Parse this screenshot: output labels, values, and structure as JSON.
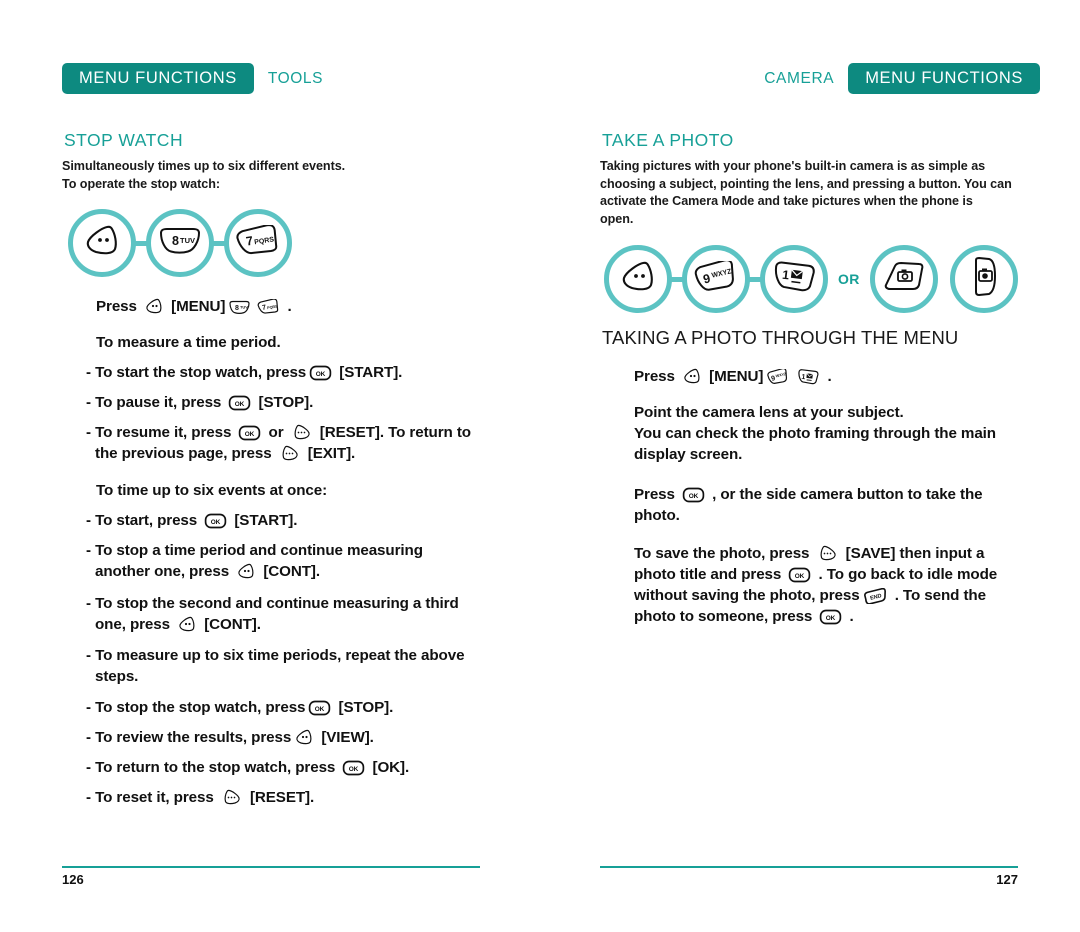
{
  "document": {
    "type": "mobile-phone-user-manual-spread",
    "accent_dark": "#0d8a80",
    "accent_mid": "#17a097",
    "accent_light": "#5cc3c3"
  },
  "left_page": {
    "running_head": {
      "badge_label": "MENU FUNCTIONS",
      "section_label": "TOOLS"
    },
    "topic_heading": "STOP WATCH",
    "intro_lines": [
      "Simultaneously times up to six different events.",
      "To operate the stop watch:"
    ],
    "key_sequence": [
      {
        "icon": "softkey-left-menu",
        "label": ""
      },
      {
        "icon": "numkey",
        "label": "8",
        "letters": "TUV"
      },
      {
        "icon": "numkey",
        "label": "7",
        "letters": "PQRS"
      }
    ],
    "steps": [
      {
        "name": "press-menu-8-7",
        "parts": [
          {
            "t": "text",
            "v": "Press "
          },
          {
            "t": "key",
            "v": "softkey-left"
          },
          {
            "t": "text",
            "v": " [MENU]"
          },
          {
            "t": "key",
            "v": "num8"
          },
          {
            "t": "key",
            "v": "num7"
          },
          {
            "t": "text",
            "v": " ."
          }
        ]
      },
      {
        "name": "measure-time-period-heading",
        "parts": [
          {
            "t": "text",
            "v": "To measure a time period."
          }
        ]
      },
      {
        "name": "start-stop-watch",
        "parts": [
          {
            "t": "text",
            "v": "- To start the stop watch, press"
          },
          {
            "t": "key",
            "v": "ok"
          },
          {
            "t": "text",
            "v": " [START]."
          }
        ]
      },
      {
        "name": "pause-it",
        "parts": [
          {
            "t": "text",
            "v": "- To pause it, press "
          },
          {
            "t": "key",
            "v": "ok"
          },
          {
            "t": "text",
            "v": " [STOP]."
          }
        ]
      },
      {
        "name": "resume-it",
        "parts": [
          {
            "t": "text",
            "v": "- To resume it, press "
          },
          {
            "t": "key",
            "v": "ok"
          },
          {
            "t": "text",
            "v": " or "
          },
          {
            "t": "key",
            "v": "softkey-right"
          },
          {
            "t": "text",
            "v": " [RESET]. To return to"
          },
          {
            "t": "br"
          },
          {
            "t": "text",
            "v": "the previous page, press "
          },
          {
            "t": "key",
            "v": "softkey-right"
          },
          {
            "t": "text",
            "v": " [EXIT]."
          }
        ]
      },
      {
        "name": "six-events-heading",
        "parts": [
          {
            "t": "text",
            "v": "To time up to six events at once:"
          }
        ]
      },
      {
        "name": "start-press",
        "parts": [
          {
            "t": "text",
            "v": "- To start, press "
          },
          {
            "t": "key",
            "v": "ok"
          },
          {
            "t": "text",
            "v": " [START]."
          }
        ]
      },
      {
        "name": "stop-and-continue",
        "parts": [
          {
            "t": "text",
            "v": "- To stop a time period and continue measuring"
          },
          {
            "t": "br"
          },
          {
            "t": "text",
            "v": "another one, press "
          },
          {
            "t": "key",
            "v": "softkey-left"
          },
          {
            "t": "text",
            "v": " [CONT]."
          }
        ]
      },
      {
        "name": "stop-second-continue-third",
        "parts": [
          {
            "t": "text",
            "v": "- To stop the second and continue measuring a third"
          },
          {
            "t": "br"
          },
          {
            "t": "text",
            "v": "one, press "
          },
          {
            "t": "key",
            "v": "softkey-left"
          },
          {
            "t": "text",
            "v": " [CONT]."
          }
        ]
      },
      {
        "name": "measure-six-periods",
        "parts": [
          {
            "t": "text",
            "v": "- To measure up to six time periods, repeat the above"
          },
          {
            "t": "br"
          },
          {
            "t": "text",
            "v": "steps."
          }
        ]
      },
      {
        "name": "stop-the-stop-watch",
        "parts": [
          {
            "t": "text",
            "v": "- To stop the stop watch, press"
          },
          {
            "t": "key",
            "v": "ok"
          },
          {
            "t": "text",
            "v": " [STOP]."
          }
        ]
      },
      {
        "name": "review-results",
        "parts": [
          {
            "t": "text",
            "v": "- To review the results, press"
          },
          {
            "t": "key",
            "v": "softkey-left"
          },
          {
            "t": "text",
            "v": " [VIEW]."
          }
        ]
      },
      {
        "name": "return-to-stop-watch",
        "parts": [
          {
            "t": "text",
            "v": "- To return to the stop watch, press "
          },
          {
            "t": "key",
            "v": "ok"
          },
          {
            "t": "text",
            "v": " [OK]."
          }
        ]
      },
      {
        "name": "reset-it",
        "parts": [
          {
            "t": "text",
            "v": "- To reset it, press "
          },
          {
            "t": "key",
            "v": "softkey-right"
          },
          {
            "t": "text",
            "v": " [RESET]."
          }
        ]
      }
    ],
    "page_number": "126"
  },
  "right_page": {
    "running_head": {
      "badge_label": "MENU FUNCTIONS",
      "section_label": "CAMERA"
    },
    "topic_heading": "TAKE A PHOTO",
    "intro_lines": [
      "Taking pictures with your phone's built-in camera is as simple as",
      "choosing a subject, pointing the lens, and pressing a button. You can",
      "activate the Camera Mode and take pictures when the phone is",
      "open."
    ],
    "key_sequence": [
      {
        "icon": "softkey-left-menu",
        "label": ""
      },
      {
        "icon": "numkey",
        "label": "9",
        "letters": "WXYZ"
      },
      {
        "icon": "numkey",
        "label": "1",
        "letters": "✉"
      }
    ],
    "key_sequence_or_label": "OR",
    "key_sequence_alt": [
      {
        "icon": "camera-key",
        "label": ""
      },
      {
        "icon": "side-camera-button",
        "label": ""
      }
    ],
    "sub_heading": "TAKING A PHOTO THROUGH THE MENU",
    "steps": [
      {
        "name": "press-menu-9-1",
        "parts": [
          {
            "t": "text",
            "v": "Press "
          },
          {
            "t": "key",
            "v": "softkey-left"
          },
          {
            "t": "text",
            "v": " [MENU]"
          },
          {
            "t": "key",
            "v": "num9"
          },
          {
            "t": "key",
            "v": "num1"
          },
          {
            "t": "text",
            "v": " ."
          }
        ]
      },
      {
        "name": "point-camera-lens",
        "parts": [
          {
            "t": "text",
            "v": "Point the camera lens at your subject."
          },
          {
            "t": "br"
          },
          {
            "t": "text",
            "v": "You can check the photo framing through the main"
          },
          {
            "t": "br"
          },
          {
            "t": "text",
            "v": "display screen."
          }
        ]
      },
      {
        "name": "press-ok-take-photo",
        "parts": [
          {
            "t": "text",
            "v": "Press "
          },
          {
            "t": "key",
            "v": "ok"
          },
          {
            "t": "text",
            "v": " , or the side camera button to take the"
          },
          {
            "t": "br"
          },
          {
            "t": "text",
            "v": "photo."
          }
        ]
      },
      {
        "name": "save-photo",
        "parts": [
          {
            "t": "text",
            "v": "To save the photo, press "
          },
          {
            "t": "key",
            "v": "softkey-right"
          },
          {
            "t": "text",
            "v": " [SAVE] then input a"
          },
          {
            "t": "br"
          },
          {
            "t": "text",
            "v": "photo title and press "
          },
          {
            "t": "key",
            "v": "ok"
          },
          {
            "t": "text",
            "v": " . To go back to idle mode"
          },
          {
            "t": "br"
          },
          {
            "t": "text",
            "v": "without saving the photo, press"
          },
          {
            "t": "key",
            "v": "end"
          },
          {
            "t": "text",
            "v": " . To send the"
          },
          {
            "t": "br"
          },
          {
            "t": "text",
            "v": "photo to someone, press "
          },
          {
            "t": "key",
            "v": "ok"
          },
          {
            "t": "text",
            "v": " ."
          }
        ]
      }
    ],
    "page_number": "127"
  }
}
